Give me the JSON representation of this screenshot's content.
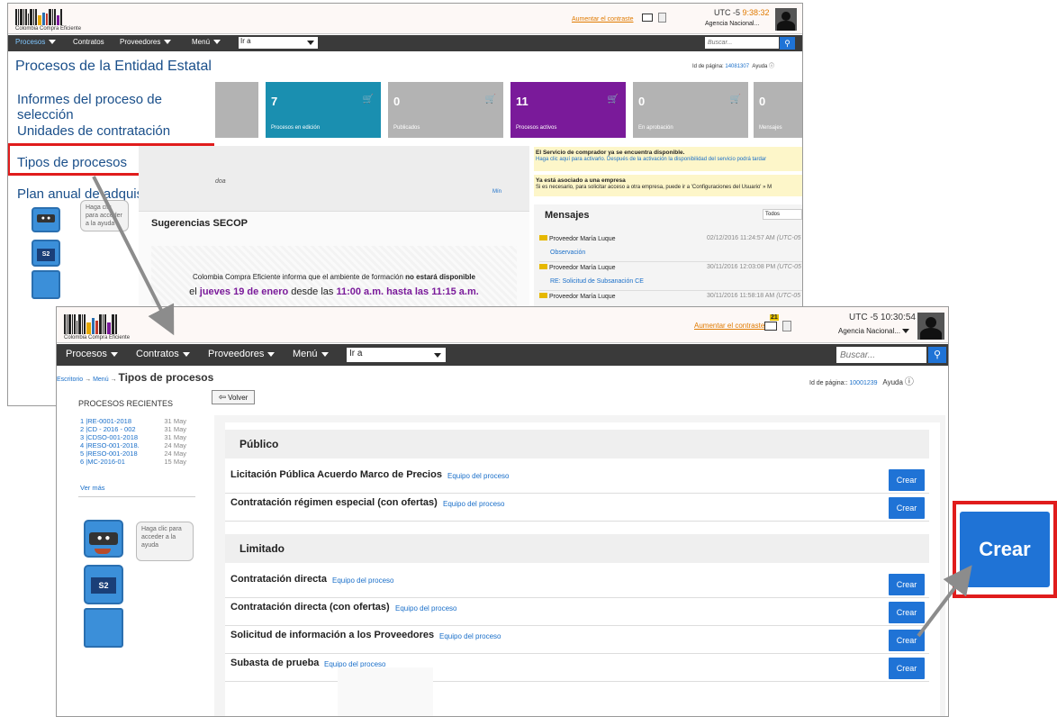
{
  "back": {
    "logo_text": "Colombia Compra Eficiente",
    "contrast_link": "Aumentar el contraste",
    "utc": "UTC -5",
    "time": "9:38:32",
    "agency": "Agencia Nacional...",
    "nav": [
      "Procesos",
      "Contratos",
      "Proveedores",
      "Menú"
    ],
    "goto": "Ir a",
    "search_placeholder": "Buscar...",
    "page_title": "Procesos de la Entidad Estatal",
    "page_id_label": "Id de página:",
    "page_id": "14081307",
    "help": "Ayuda",
    "menu": [
      "Informes del proceso de selección",
      "Unidades de contratación",
      "Tipos de procesos",
      "Plan anual de adquisiciones"
    ],
    "tiles": [
      {
        "num": "7",
        "label": "Procesos en edición",
        "color": "#1a8fb0"
      },
      {
        "num": "0",
        "label": "Publicados",
        "color": "#b3b3b3"
      },
      {
        "num": "11",
        "label": "Procesos activos",
        "color": "#7a1a9a"
      },
      {
        "num": "0",
        "label": "En aprobación",
        "color": "#b3b3b3"
      },
      {
        "num": "0",
        "label": "Mensajes",
        "color": "#b3b3b3"
      }
    ],
    "notice1_title": "El Servicio de comprador ya se encuentra disponible.",
    "notice1_text": "Haga clic aquí para activarlo. Después de la activación la disponibilidad del servicio podrá tardar",
    "notice2_title": "Ya está asociado a una empresa",
    "notice2_text": "Si es necesario, para solicitar acceso a otra empresa, puede ir a 'Configuraciones del Usuario' » M",
    "fragment_doa": "doa",
    "fragment_min": "Mín",
    "sugerencias_title": "Sugerencias SECOP",
    "sug_line1a": "Colombia Compra Eficiente informa que el ambiente de formación ",
    "sug_line1b": "no estará disponible",
    "sug_line2a": "el ",
    "sug_line2b": "jueves 19 de enero",
    "sug_line2c": " desde las ",
    "sug_line2d": "11:00 a.m. hasta las 11:15 a.m.",
    "mensajes_title": "Mensajes",
    "mensajes_filter": "Todos",
    "messages": [
      {
        "from": "Proveedor María Luque",
        "date": "02/12/2016 11:24:57 AM",
        "tz": "(UTC-05",
        "subject": "Observación"
      },
      {
        "from": "Proveedor María Luque",
        "date": "30/11/2016 12:03:08 PM",
        "tz": "(UTC-05",
        "subject": "RE: Solicitud de Subsanación CE"
      },
      {
        "from": "Proveedor María Luque",
        "date": "30/11/2016 11:58:18 AM",
        "tz": "(UTC-05",
        "subject": ""
      }
    ],
    "bubble": "Haga clic para acceder a la ayuda"
  },
  "front": {
    "logo_text": "Colombia Compra Eficiente",
    "contrast_link": "Aumentar el contraste",
    "mail_badge": "21",
    "utc": "UTC -5",
    "time": "10:30:54",
    "agency": "Agencia Nacional...",
    "nav": [
      "Procesos",
      "Contratos",
      "Proveedores",
      "Menú"
    ],
    "goto": "Ir a",
    "search_placeholder": "Buscar...",
    "breadcrumb": [
      "Escritorio",
      "Menú"
    ],
    "page_title": "Tipos de procesos",
    "page_id_label": "Id de página::",
    "page_id": "10001239",
    "help": "Ayuda",
    "back_button": "Volver",
    "recent_title": "PROCESOS RECIENTES",
    "recent": [
      {
        "id": "1 |RE-0001-2018",
        "date": "31 May"
      },
      {
        "id": "2 |CD - 2016 - 002",
        "date": "31 May"
      },
      {
        "id": "3 |CDSO-001-2018",
        "date": "31 May"
      },
      {
        "id": "4 |RESO-001-2018.",
        "date": "24 May"
      },
      {
        "id": "5 |RESO-001-2018",
        "date": "24 May"
      },
      {
        "id": "6 |MC-2016-01",
        "date": "15 May"
      }
    ],
    "see_more": "Ver más",
    "bubble": "Haga clic para acceder a la ayuda",
    "sections": [
      {
        "title": "Público",
        "items": [
          {
            "name": "Licitación Pública Acuerdo Marco de Precios",
            "team": "Equipo del proceso",
            "action": "Crear"
          },
          {
            "name": "Contratación régimen especial (con ofertas)",
            "team": "Equipo del proceso",
            "action": "Crear"
          }
        ]
      },
      {
        "title": "Limitado",
        "items": [
          {
            "name": "Contratación directa",
            "team": "Equipo del proceso",
            "action": "Crear"
          },
          {
            "name": "Contratación directa (con ofertas)",
            "team": "Equipo del proceso",
            "action": "Crear"
          },
          {
            "name": "Solicitud de información a los Proveedores",
            "team": "Equipo del proceso",
            "action": "Crear"
          },
          {
            "name": "Subasta de prueba",
            "team": "Equipo del proceso",
            "action": "Crear"
          }
        ]
      }
    ]
  },
  "callout": {
    "label": "Crear"
  },
  "robot_badge": "S2"
}
